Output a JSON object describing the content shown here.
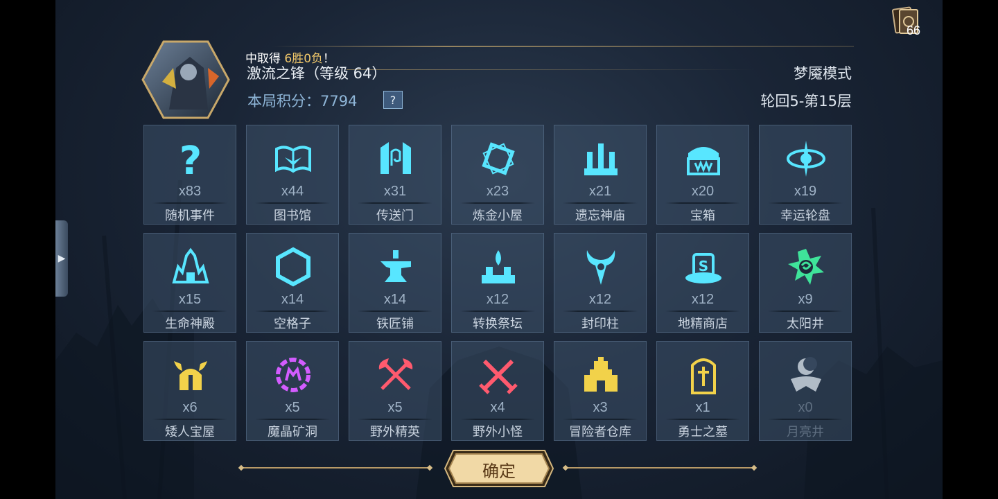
{
  "header": {
    "result_prefix": "中取得 ",
    "result_highlight": "6胜0负",
    "result_suffix": "！",
    "hero_name": "激流之锋（等级 64）",
    "score_label": "本局积分：",
    "score_value": "7794",
    "help_symbol": "?",
    "mode": "梦魇模式",
    "floor": "轮回5-第15层"
  },
  "deck": {
    "count": "66"
  },
  "events": [
    {
      "icon": "question-mark-icon",
      "count": "x83",
      "label": "随机事件",
      "color": "#58e6ff"
    },
    {
      "icon": "open-book-icon",
      "count": "x44",
      "label": "图书馆",
      "color": "#58e6ff"
    },
    {
      "icon": "portal-gate-icon",
      "count": "x31",
      "label": "传送门",
      "color": "#58e6ff"
    },
    {
      "icon": "alchemy-diamond-icon",
      "count": "x23",
      "label": "炼金小屋",
      "color": "#58e6ff"
    },
    {
      "icon": "temple-pillars-icon",
      "count": "x21",
      "label": "遗忘神庙",
      "color": "#58e6ff"
    },
    {
      "icon": "treasure-chest-icon",
      "count": "x20",
      "label": "宝箱",
      "color": "#58e6ff"
    },
    {
      "icon": "lucky-wheel-icon",
      "count": "x19",
      "label": "幸运轮盘",
      "color": "#58e6ff"
    },
    {
      "icon": "life-shrine-icon",
      "count": "x15",
      "label": "生命神殿",
      "color": "#58e6ff"
    },
    {
      "icon": "hexagon-icon",
      "count": "x14",
      "label": "空格子",
      "color": "#58e6ff"
    },
    {
      "icon": "anvil-icon",
      "count": "x14",
      "label": "铁匠铺",
      "color": "#58e6ff"
    },
    {
      "icon": "altar-icon",
      "count": "x12",
      "label": "转换祭坛",
      "color": "#58e6ff"
    },
    {
      "icon": "seal-pillar-icon",
      "count": "x12",
      "label": "封印柱",
      "color": "#58e6ff"
    },
    {
      "icon": "goblin-shop-icon",
      "count": "x12",
      "label": "地精商店",
      "color": "#58e6ff"
    },
    {
      "icon": "sun-well-icon",
      "count": "x9",
      "label": "太阳井",
      "color": "#3fe39a"
    },
    {
      "icon": "dwarf-helmet-icon",
      "count": "x6",
      "label": "矮人宝屋",
      "color": "#f2d24a"
    },
    {
      "icon": "magic-crystal-icon",
      "count": "x5",
      "label": "魔晶矿洞",
      "color": "#d35cff"
    },
    {
      "icon": "crossed-axes-icon",
      "count": "x5",
      "label": "野外精英",
      "color": "#ff5a6e"
    },
    {
      "icon": "crossed-swords-icon",
      "count": "x4",
      "label": "野外小怪",
      "color": "#ff5a6e"
    },
    {
      "icon": "warehouse-castle-icon",
      "count": "x3",
      "label": "冒险者仓库",
      "color": "#f2d24a"
    },
    {
      "icon": "tombstone-icon",
      "count": "x1",
      "label": "勇士之墓",
      "color": "#f2d24a"
    },
    {
      "icon": "moon-well-icon",
      "count": "x0",
      "label": "月亮井",
      "color": "#dfe8f0"
    }
  ],
  "footer": {
    "confirm_label": "确定"
  }
}
